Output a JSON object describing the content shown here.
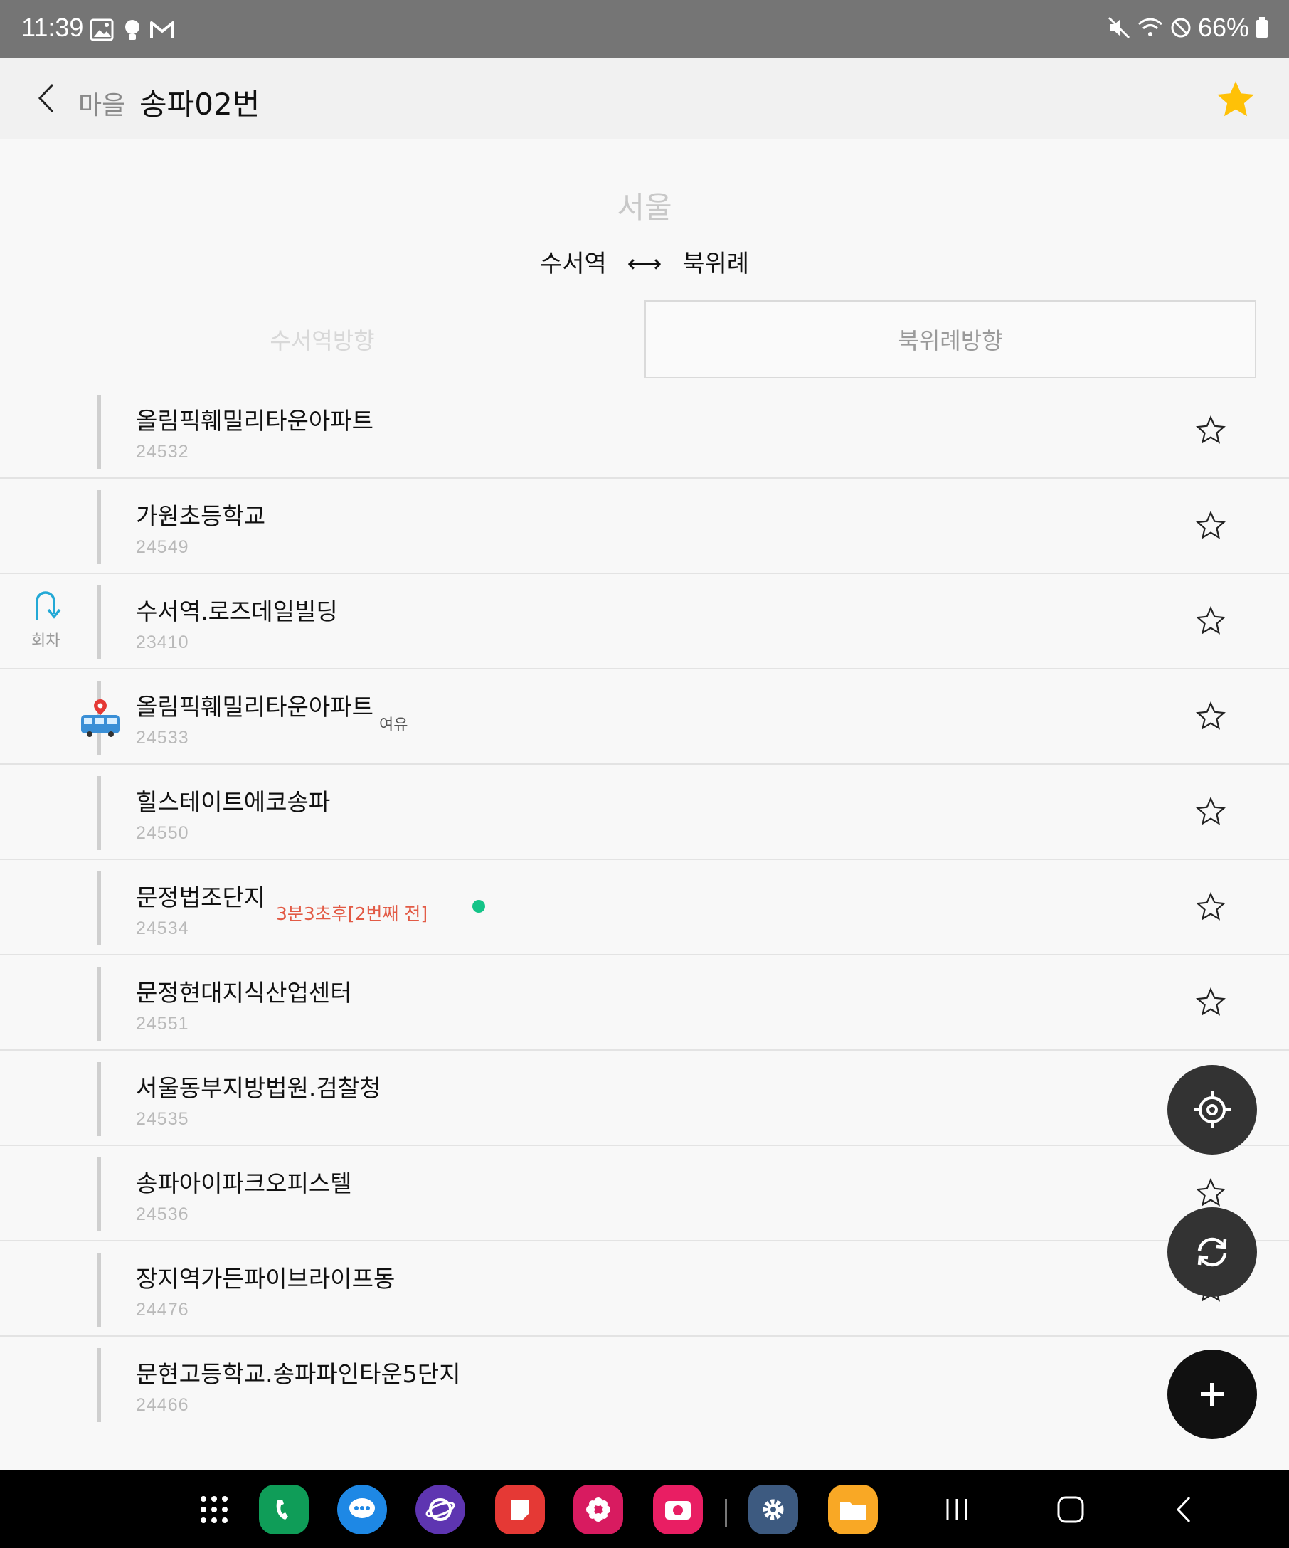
{
  "status_bar": {
    "time": "11:39",
    "battery": "66%",
    "left_icons": [
      "gallery-icon",
      "bulb-icon",
      "gmail-icon"
    ],
    "right_icons": [
      "mute-icon",
      "wifi-icon",
      "dnd-icon",
      "battery-icon"
    ]
  },
  "header": {
    "category": "마을",
    "title": "송파02번",
    "favorite_color": "#FFC107"
  },
  "route": {
    "region": "서울",
    "from": "수서역",
    "arrow": "⟷",
    "to": "북위례"
  },
  "tabs": [
    {
      "label": "수서역방향",
      "selected": false
    },
    {
      "label": "북위례방향",
      "selected": true
    }
  ],
  "stops": [
    {
      "name": "올림픽훼밀리타운아파트",
      "id": "24532"
    },
    {
      "name": "가원초등학교",
      "id": "24549"
    },
    {
      "name": "수서역.로즈데일빌딩",
      "id": "23410",
      "turn_label": "회차"
    },
    {
      "name": "올림픽훼밀리타운아파트",
      "id": "24533",
      "crowd": "여유",
      "bus_here": true
    },
    {
      "name": "힐스테이트에코송파",
      "id": "24550"
    },
    {
      "name": "문정법조단지",
      "id": "24534",
      "arrival": "3분3초후[2번째 전]"
    },
    {
      "name": "문정현대지식산업센터",
      "id": "24551"
    },
    {
      "name": "서울동부지방법원.검찰청",
      "id": "24535"
    },
    {
      "name": "송파아이파크오피스텔",
      "id": "24536"
    },
    {
      "name": "장지역가든파이브라이프동",
      "id": "24476"
    },
    {
      "name": "문현고등학교.송파파인타운5단지",
      "id": "24466"
    }
  ],
  "colors": {
    "accent_turn": "#23A9D6",
    "arrival_text": "#E25A45",
    "bus_dot": "#14C488"
  },
  "fabs": [
    "locate-icon",
    "refresh-icon",
    "add-icon"
  ],
  "dock_apps": [
    "apps-icon",
    "phone-icon",
    "messages-icon",
    "internet-icon",
    "notes-icon",
    "bixby-icon",
    "camera-icon",
    "settings-icon",
    "files-icon"
  ]
}
